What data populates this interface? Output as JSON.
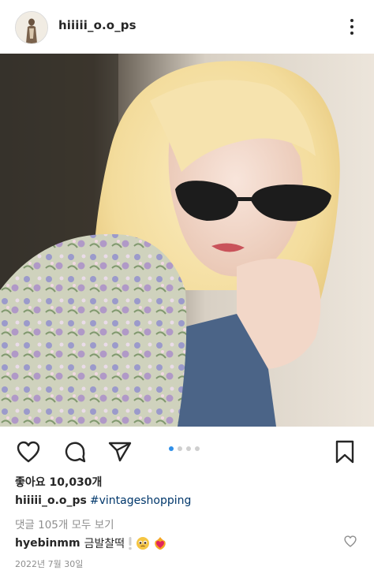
{
  "header": {
    "username": "hiiiii_o.o_ps",
    "avatar_icon": "profile-avatar",
    "more_icon": "more-vertical-icon"
  },
  "post": {
    "photo_alt": "Selfie with sunglasses",
    "carousel": {
      "total": 4,
      "active": 1
    },
    "likes_label": "좋아요 10,030개",
    "caption_user": "hiiiii_o.o_ps",
    "caption_tag": "#vintageshopping",
    "view_comments": "댓글 105개 모두 보기",
    "comment_user": "hyebinmm",
    "comment_text": "금발찰떡",
    "comment_emojis": [
      "pleading-face",
      "heart-on-fire"
    ],
    "date": "2022년 7월 30일"
  },
  "actions": {
    "like_icon": "heart-icon",
    "comment_icon": "comment-icon",
    "share_icon": "share-icon",
    "save_icon": "bookmark-icon"
  },
  "colors": {
    "accent_blue": "#2f8fe8",
    "hashtag": "#00376b",
    "muted_text": "#8e8e8e"
  }
}
